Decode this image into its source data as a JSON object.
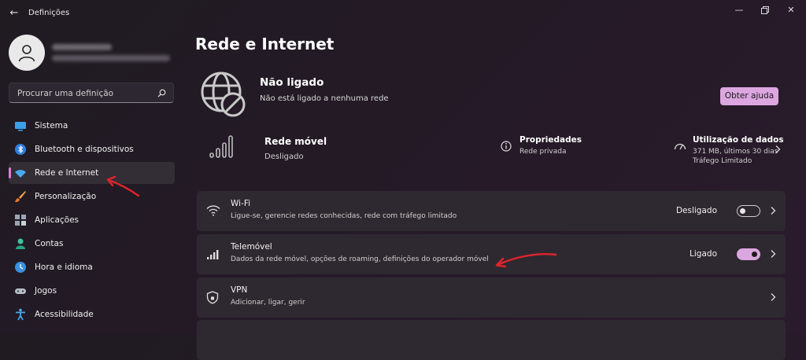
{
  "window": {
    "title": "Definições",
    "controls": [
      "minimize",
      "restore",
      "close"
    ]
  },
  "profile": {
    "avatar_icon": "person-icon"
  },
  "search": {
    "placeholder": "Procurar uma definição"
  },
  "sidebar": {
    "items": [
      {
        "label": "Sistema",
        "icon": "system-icon",
        "active": false
      },
      {
        "label": "Bluetooth e dispositivos",
        "icon": "bluetooth-icon",
        "active": false
      },
      {
        "label": "Rede e Internet",
        "icon": "wifi-icon",
        "active": true
      },
      {
        "label": "Personalização",
        "icon": "brush-icon",
        "active": false
      },
      {
        "label": "Aplicações",
        "icon": "apps-icon",
        "active": false
      },
      {
        "label": "Contas",
        "icon": "account-icon",
        "active": false
      },
      {
        "label": "Hora e idioma",
        "icon": "clock-globe-icon",
        "active": false
      },
      {
        "label": "Jogos",
        "icon": "gamepad-icon",
        "active": false
      },
      {
        "label": "Acessibilidade",
        "icon": "accessibility-icon",
        "active": false
      }
    ]
  },
  "page": {
    "title": "Rede e Internet"
  },
  "status": {
    "title": "Não ligado",
    "subtitle": "Não está ligado a nenhuma rede",
    "help_button": "Obter ajuda"
  },
  "mobile": {
    "title": "Rede móvel",
    "subtitle": "Desligado",
    "properties": {
      "title": "Propriedades",
      "subtitle": "Rede privada"
    },
    "data_usage": {
      "title": "Utilização de dados",
      "line1": "371 MB, últimos 30 dias",
      "line2": "Tráfego Limitado"
    }
  },
  "cards": [
    {
      "title": "Wi-Fi",
      "subtitle": "Ligue-se, gerencie redes conhecidas, rede com tráfego limitado",
      "state": "Desligado",
      "toggle": "off"
    },
    {
      "title": "Telemóvel",
      "subtitle": "Dados da rede móvel, opções de roaming, definições do operador móvel",
      "state": "Ligado",
      "toggle": "on"
    },
    {
      "title": "VPN",
      "subtitle": "Adicionar, ligar, gerir"
    }
  ],
  "colors": {
    "accent": "#dca6e0",
    "annotation_arrow": "#e0242b",
    "background": "#221b24",
    "card": "#2e2930"
  }
}
